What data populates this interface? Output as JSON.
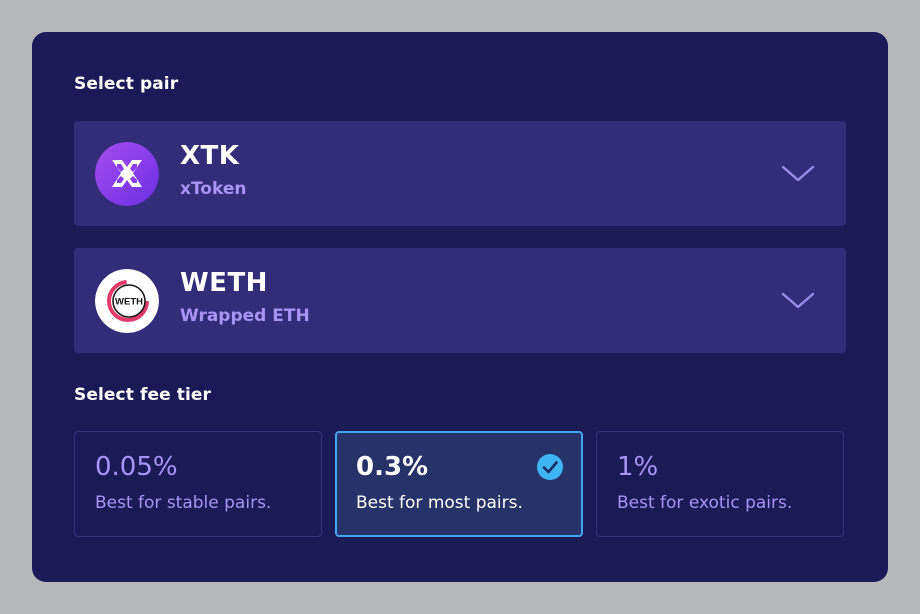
{
  "pair_section": {
    "label": "Select pair",
    "tokens": [
      {
        "symbol": "XTK",
        "name": "xToken",
        "icon": "xtoken-logo-icon"
      },
      {
        "symbol": "WETH",
        "name": "Wrapped ETH",
        "icon": "weth-logo-icon",
        "logo_text": "WETH"
      }
    ]
  },
  "fee_section": {
    "label": "Select fee tier",
    "tiers": [
      {
        "value": "0.05%",
        "description": "Best for stable pairs.",
        "selected": false
      },
      {
        "value": "0.3%",
        "description": "Best for most pairs.",
        "selected": true
      },
      {
        "value": "1%",
        "description": "Best for exotic pairs.",
        "selected": false
      }
    ]
  },
  "colors": {
    "background": "#b7b8ba",
    "panel": "#1c1957",
    "select_bg": "#332c79",
    "accent_text": "#a794f5",
    "selected_border": "#3fa9f0",
    "check": "#3fb4f5"
  }
}
